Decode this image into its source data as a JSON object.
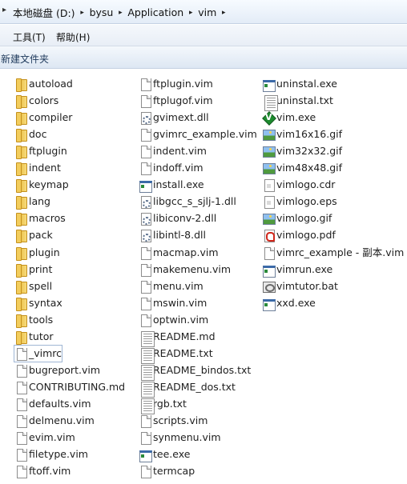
{
  "breadcrumb": [
    "本地磁盘 (D:)",
    "bysu",
    "Application",
    "vim"
  ],
  "menu": {
    "tools": "工具(T)",
    "help": "帮助(H)"
  },
  "toolbar": {
    "new_folder": "新建文件夹"
  },
  "columns": [
    [
      {
        "name": "autoload",
        "icon": "folder-icon"
      },
      {
        "name": "colors",
        "icon": "folder-icon"
      },
      {
        "name": "compiler",
        "icon": "folder-icon"
      },
      {
        "name": "doc",
        "icon": "folder-icon"
      },
      {
        "name": "ftplugin",
        "icon": "folder-icon"
      },
      {
        "name": "indent",
        "icon": "folder-icon"
      },
      {
        "name": "keymap",
        "icon": "folder-icon"
      },
      {
        "name": "lang",
        "icon": "folder-icon"
      },
      {
        "name": "macros",
        "icon": "folder-icon"
      },
      {
        "name": "pack",
        "icon": "folder-icon"
      },
      {
        "name": "plugin",
        "icon": "folder-icon"
      },
      {
        "name": "print",
        "icon": "folder-icon"
      },
      {
        "name": "spell",
        "icon": "folder-icon"
      },
      {
        "name": "syntax",
        "icon": "folder-icon"
      },
      {
        "name": "tools",
        "icon": "folder-icon"
      },
      {
        "name": "tutor",
        "icon": "folder-icon"
      },
      {
        "name": "_vimrc",
        "icon": "document-icon",
        "selected": true
      },
      {
        "name": "bugreport.vim",
        "icon": "document-icon"
      },
      {
        "name": "CONTRIBUTING.md",
        "icon": "document-icon"
      },
      {
        "name": "defaults.vim",
        "icon": "document-icon"
      },
      {
        "name": "delmenu.vim",
        "icon": "document-icon"
      },
      {
        "name": "evim.vim",
        "icon": "document-icon"
      },
      {
        "name": "filetype.vim",
        "icon": "document-icon"
      },
      {
        "name": "ftoff.vim",
        "icon": "document-icon"
      }
    ],
    [
      {
        "name": "ftplugin.vim",
        "icon": "document-icon"
      },
      {
        "name": "ftplugof.vim",
        "icon": "document-icon"
      },
      {
        "name": "gvimext.dll",
        "icon": "dll-icon"
      },
      {
        "name": "gvimrc_example.vim",
        "icon": "document-icon"
      },
      {
        "name": "indent.vim",
        "icon": "document-icon"
      },
      {
        "name": "indoff.vim",
        "icon": "document-icon"
      },
      {
        "name": "install.exe",
        "icon": "exe-icon"
      },
      {
        "name": "libgcc_s_sjlj-1.dll",
        "icon": "dll-icon"
      },
      {
        "name": "libiconv-2.dll",
        "icon": "dll-icon"
      },
      {
        "name": "libintl-8.dll",
        "icon": "dll-icon"
      },
      {
        "name": "macmap.vim",
        "icon": "document-icon"
      },
      {
        "name": "makemenu.vim",
        "icon": "document-icon"
      },
      {
        "name": "menu.vim",
        "icon": "document-icon"
      },
      {
        "name": "mswin.vim",
        "icon": "document-icon"
      },
      {
        "name": "optwin.vim",
        "icon": "document-icon"
      },
      {
        "name": "README.md",
        "icon": "text-document-icon"
      },
      {
        "name": "README.txt",
        "icon": "text-document-icon"
      },
      {
        "name": "README_bindos.txt",
        "icon": "text-document-icon"
      },
      {
        "name": "README_dos.txt",
        "icon": "text-document-icon"
      },
      {
        "name": "rgb.txt",
        "icon": "text-document-icon"
      },
      {
        "name": "scripts.vim",
        "icon": "document-icon"
      },
      {
        "name": "synmenu.vim",
        "icon": "document-icon"
      },
      {
        "name": "tee.exe",
        "icon": "exe-icon"
      },
      {
        "name": "termcap",
        "icon": "document-icon"
      }
    ],
    [
      {
        "name": "uninstal.exe",
        "icon": "exe-icon"
      },
      {
        "name": "uninstal.txt",
        "icon": "text-document-icon"
      },
      {
        "name": "vim.exe",
        "icon": "vim-icon"
      },
      {
        "name": "vim16x16.gif",
        "icon": "image-icon"
      },
      {
        "name": "vim32x32.gif",
        "icon": "image-icon"
      },
      {
        "name": "vim48x48.gif",
        "icon": "image-icon"
      },
      {
        "name": "vimlogo.cdr",
        "icon": "graphic-document-icon"
      },
      {
        "name": "vimlogo.eps",
        "icon": "graphic-document-icon"
      },
      {
        "name": "vimlogo.gif",
        "icon": "image-icon"
      },
      {
        "name": "vimlogo.pdf",
        "icon": "pdf-icon"
      },
      {
        "name": "vimrc_example - 副本.vim",
        "icon": "document-icon"
      },
      {
        "name": "vimrun.exe",
        "icon": "exe-icon"
      },
      {
        "name": "vimtutor.bat",
        "icon": "batch-file-icon"
      },
      {
        "name": "xxd.exe",
        "icon": "exe-icon"
      }
    ]
  ]
}
